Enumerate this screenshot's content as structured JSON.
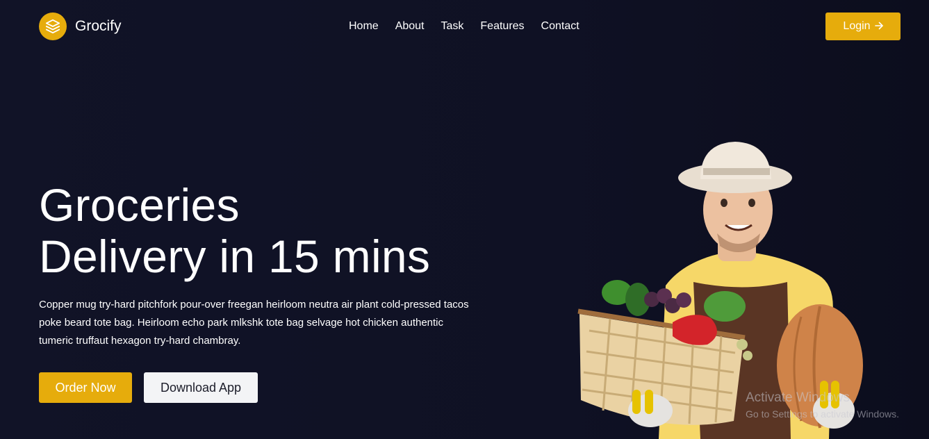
{
  "brand": {
    "name": "Grocify",
    "icon": "layers-icon",
    "accent": "#e6ac0c"
  },
  "nav": {
    "items": [
      "Home",
      "About",
      "Task",
      "Features",
      "Contact"
    ]
  },
  "login": {
    "label": "Login",
    "icon": "arrow-right-icon"
  },
  "hero": {
    "title_line1": "Groceries",
    "title_line2": "Delivery in 15 mins",
    "description": "Copper mug try-hard pitchfork pour-over freegan heirloom neutra air plant cold-pressed tacos poke beard tote bag. Heirloom echo park mlkshk tote bag selvage hot chicken authentic tumeric truffaut hexagon try-hard chambray.",
    "order_button": "Order Now",
    "download_button": "Download App"
  },
  "watermark": {
    "title": "Activate Windows",
    "subtitle": "Go to Settings to activate Windows."
  }
}
